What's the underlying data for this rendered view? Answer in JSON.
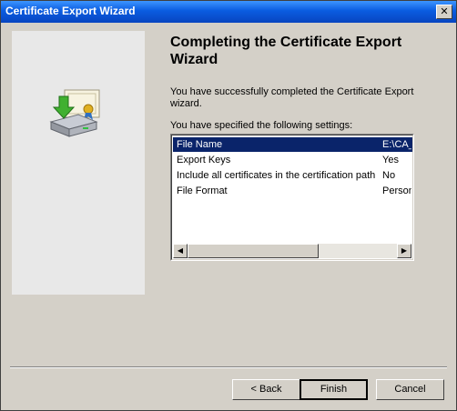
{
  "window": {
    "title": "Certificate Export Wizard",
    "close_glyph": "✕"
  },
  "wizard": {
    "heading": "Completing the Certificate Export Wizard",
    "message": "You have successfully completed the Certificate Export wizard.",
    "settings_label": "You have specified the following settings:"
  },
  "settings": [
    {
      "name": "File Name",
      "value": "E:\\CA_"
    },
    {
      "name": "Export Keys",
      "value": "Yes"
    },
    {
      "name": "Include all certificates in the certification path",
      "value": "No"
    },
    {
      "name": "File Format",
      "value": "Person"
    }
  ],
  "scrollbar": {
    "left_glyph": "◀",
    "right_glyph": "▶"
  },
  "buttons": {
    "back": "< Back",
    "finish": "Finish",
    "cancel": "Cancel"
  },
  "colors": {
    "title_bar": "#0a5ce0",
    "selection": "#0a246a",
    "dialog": "#d4d0c8"
  },
  "icons": [
    "certificate-icon",
    "export-arrow-icon",
    "disk-drive-icon"
  ]
}
